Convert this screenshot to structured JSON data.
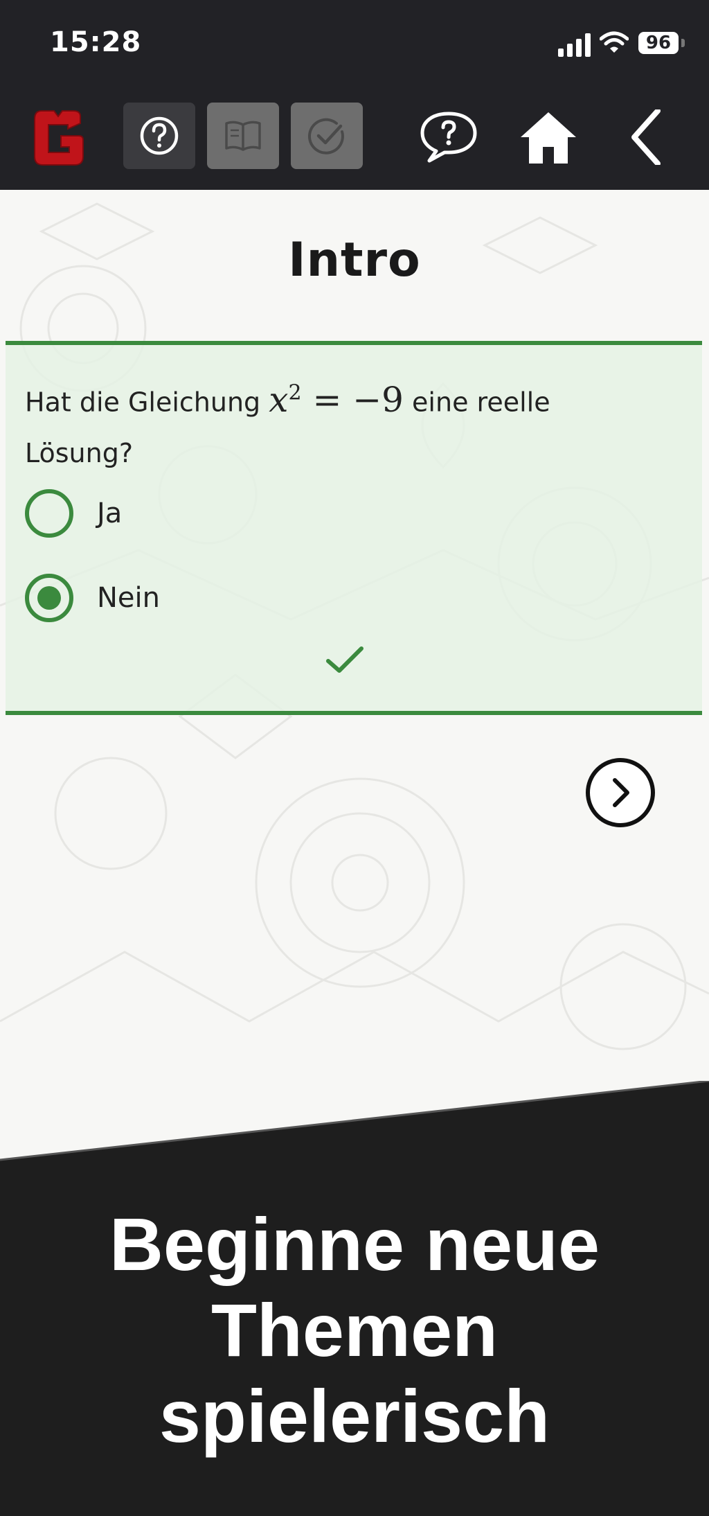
{
  "status_bar": {
    "time": "15:28",
    "battery": "96",
    "icons": [
      "signal-icon",
      "wifi-icon",
      "battery-icon"
    ]
  },
  "toolbar": {
    "icons": [
      "logo",
      "help-icon",
      "book-icon",
      "check-icon",
      "chat-icon",
      "home-icon",
      "back-icon"
    ]
  },
  "lesson": {
    "title": "Intro",
    "question_prefix": "Hat die Gleichung ",
    "math_var": "x",
    "math_exp": "2",
    "math_rest": "= −9",
    "question_suffix": " eine reelle Lösung?",
    "options": [
      {
        "label": "Ja",
        "selected": false
      },
      {
        "label": "Nein",
        "selected": true
      }
    ],
    "answer_correct": true
  },
  "promo": {
    "lines": [
      "Beginne neue",
      "Themen",
      "spielerisch"
    ]
  },
  "colors": {
    "bar": "#222226",
    "accent_green": "#3b8a3e",
    "logo_red": "#c0141a",
    "card_bg": "#e4f2e4"
  }
}
